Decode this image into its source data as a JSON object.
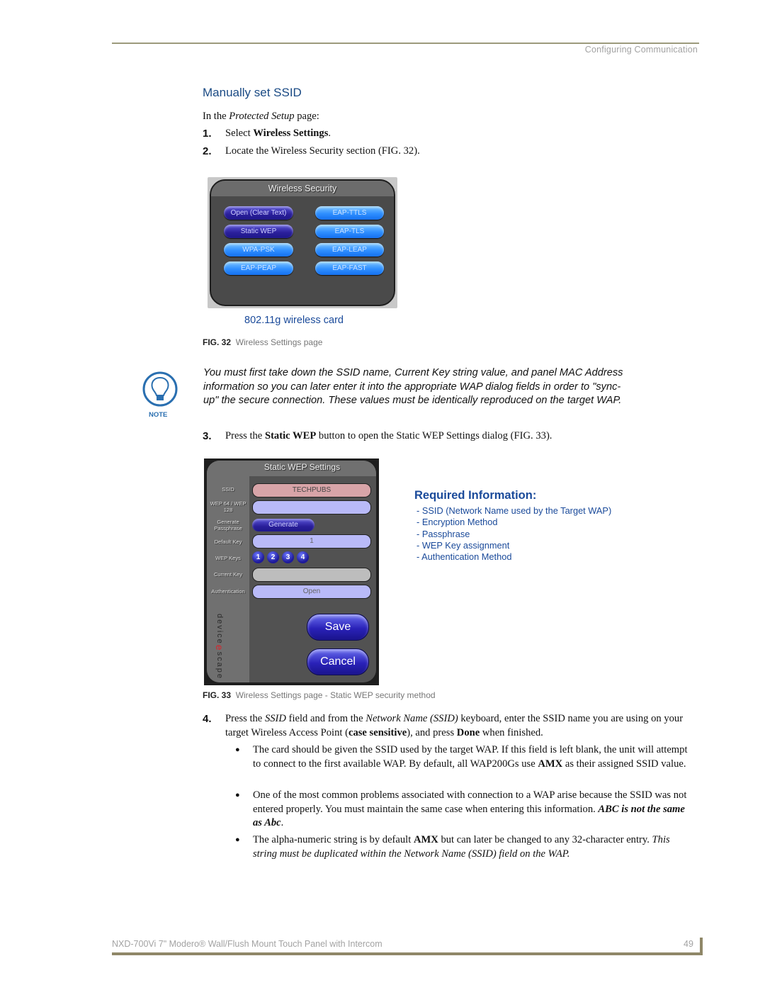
{
  "header": {
    "section": "Configuring Communication"
  },
  "heading": "Manually set SSID",
  "intro": {
    "prefix": "In the ",
    "page_name": "Protected Setup",
    "suffix": " page:"
  },
  "steps": [
    {
      "num": "1.",
      "prefix": "Select ",
      "bold": "Wireless Settings",
      "suffix": "."
    },
    {
      "num": "2.",
      "text": "Locate the Wireless Security section (FIG. 32)."
    },
    {
      "num": "3.",
      "prefix": "Press the ",
      "bold": "Static WEP",
      "suffix": " button to open the Static WEP Settings dialog (FIG. 33)."
    },
    {
      "num": "4.",
      "p1": "Press the ",
      "i1": "SSID",
      "p2": " field and from the ",
      "i2": "Network Name (SSID)",
      "p3": " keyboard, enter the SSID name you are using on your target Wireless Access Point (",
      "b1": "case sensitive",
      "p4": "), and press ",
      "b2": "Done",
      "p5": " when finished."
    }
  ],
  "wireless_security": {
    "title": "Wireless Security",
    "buttons_left": [
      "Open (Clear Text)",
      "Static WEP",
      "WPA-PSK",
      "EAP-PEAP"
    ],
    "buttons_right": [
      "EAP-TTLS",
      "EAP-TLS",
      "EAP-LEAP",
      "EAP-FAST"
    ],
    "card_label": "802.11g wireless card"
  },
  "fig32": {
    "num": "FIG. 32",
    "caption": "Wireless Settings page"
  },
  "note": {
    "label": "NOTE",
    "text": "You must first take down the SSID name, Current Key string value, and panel MAC Address information so you can later enter it into the appropriate WAP dialog fields in order to \"sync-up\" the secure connection. These values must be identically reproduced on the target WAP."
  },
  "static_wep": {
    "title": "Static WEP Settings",
    "labels": {
      "ssid": "SSID",
      "wep": "WEP 64 / WEP 128",
      "generate": "Generate Passphrase",
      "default_key": "Default Key",
      "wep_keys": "WEP Keys",
      "current_key": "Current Key",
      "authentication": "Authentication"
    },
    "ssid_value": "TECHPUBS",
    "wep_value": "",
    "generate_label": "Generate",
    "default_key_value": "1",
    "wep_keys": [
      "1",
      "2",
      "3",
      "4"
    ],
    "current_key_value": "",
    "authentication_value": "Open",
    "save_label": "Save",
    "cancel_label": "Cancel",
    "logo": {
      "before": "device",
      "e": "e",
      "after": "scape"
    }
  },
  "required_info": {
    "title": "Required Information:",
    "items": [
      "- SSID (Network Name used by the Target WAP)",
      "- Encryption Method",
      "- Passphrase",
      "- WEP Key assignment",
      "- Authentication Method"
    ]
  },
  "fig33": {
    "num": "FIG. 33",
    "caption": "Wireless Settings page - Static WEP security method"
  },
  "bullets": [
    {
      "p1": "The card should be given the SSID used by the target WAP. If this field is left blank, the unit will attempt to connect to the first available WAP. By default, all WAP200Gs use ",
      "b1": "AMX",
      "p2": " as their assigned SSID value."
    },
    {
      "p1": "One of the most common problems associated with connection to a WAP arise because the SSID was not entered properly. You must maintain the same case when entering this information. ",
      "bi": "ABC is not the same as Abc",
      "p2": "."
    },
    {
      "p1": "The alpha-numeric string is by default ",
      "b1": "AMX",
      "p2": " but can later be changed to any 32-character entry. ",
      "i1": "This string must be duplicated within the Network Name (SSID) field on the WAP."
    }
  ],
  "footer": {
    "title": "NXD-700Vi 7\" Modero® Wall/Flush Mount Touch Panel with Intercom",
    "page": "49"
  }
}
